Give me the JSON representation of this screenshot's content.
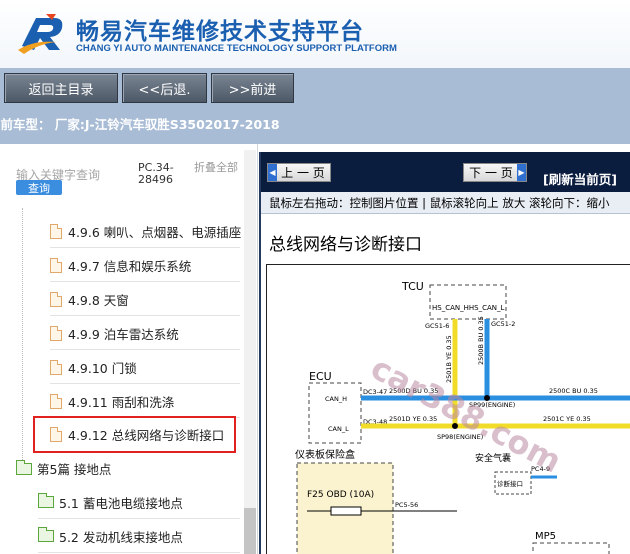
{
  "header": {
    "title_cn": "畅易汽车维修技术支持平台",
    "title_en": "CHANG YI AUTO MAINTENANCE TECHNOLOGY SUPPORT PLATFORM"
  },
  "toolbar": {
    "home": "返回主目录",
    "back": "<<后退.",
    "forward": ">>前进"
  },
  "current_model": "当前车型： 厂家:J-江铃汽车驭胜S3502017-2018",
  "left": {
    "search_placeholder": "输入关键字查询",
    "query": "查询",
    "pc_number": "PC.34-28496",
    "collapse": "折叠全部",
    "tree": [
      {
        "label": "4.9.6 喇叭、点烟器、电源插座"
      },
      {
        "label": "4.9.7 信息和娱乐系统"
      },
      {
        "label": "4.9.8 天窗"
      },
      {
        "label": "4.9.9 泊车雷达系统"
      },
      {
        "label": "4.9.10 门锁"
      },
      {
        "label": "4.9.11 雨刮和洗涤"
      },
      {
        "label": "4.9.12 总线网络与诊断接口"
      },
      {
        "label": "第5篇 接地点"
      },
      {
        "label": "5.1 蓄电池电缆接地点"
      },
      {
        "label": "5.2 发动机线束接地点"
      }
    ]
  },
  "right": {
    "prev": "上 一 页",
    "next": "下 一 页",
    "refresh": "[刷新当前页]",
    "tip": "鼠标左右拖动：控制图片位置 | 鼠标滚轮向上 放大   滚轮向下：缩小",
    "doc_title": "总线网络与诊断接口"
  },
  "diagram": {
    "tcu": "TCU",
    "tcu_pins": "HS_CAN_HHS_CAN_L",
    "gc51_6": "GC51-6",
    "gc51_2": "GC51-2",
    "w2501b": "2501B YE 0.35",
    "w2500b": "2500B BU 0.35",
    "ecu": "ECU",
    "can_h": "CAN_H",
    "can_l": "CAN_L",
    "dc3_47": "DC3-47",
    "dc3_48": "DC3-48",
    "w2500d": "2500D BU 0.35",
    "w2501d": "2501D YE 0.35",
    "w2500c": "2500C BU 0.35",
    "w2501c": "2501C YE 0.35",
    "sp99": "SP99(ENGINE)",
    "sp98": "SP98(ENGINE)",
    "fusebox": "仪表板保险盒",
    "fuse": "F25  OBD  (10A)",
    "pc5_56": "PC5-56",
    "airbag": "安全气囊",
    "diag": "诊断接口",
    "pc4_9": "PC4-9",
    "mp5": "MP5",
    "watermark": "car388.com"
  }
}
